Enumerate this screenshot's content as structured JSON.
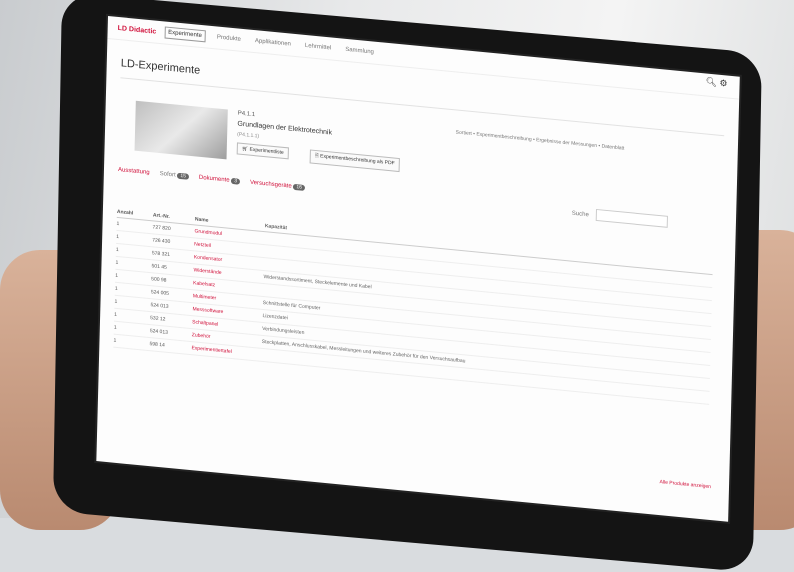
{
  "page": {
    "title": "LD-Experimente",
    "brand": "LD Didactic",
    "nav_tabs": [
      "Experimente",
      "Produkte",
      "Applikationen",
      "Lehrmittel",
      "Sammlung"
    ],
    "search_icon": "search-icon",
    "settings_icon": "gear-icon"
  },
  "product": {
    "number": "P4.1.1",
    "name": "Grundlagen der Elektrotechnik",
    "variant": "(P4.1.1.1)",
    "cart_label": "Experimentliste",
    "pdf_label": "Experimentbeschreibung als PDF",
    "info": "Sortiert • Experimentbeschreibung • Ergebnisse der Messungen • Datenblatt"
  },
  "tabs": {
    "items": [
      {
        "label": "Ausstattung",
        "active": true
      },
      {
        "label": "Sofort",
        "badge": "15",
        "active": false
      },
      {
        "label": "Dokumente",
        "badge": "3",
        "active": true
      },
      {
        "label": "Versuchsgeräte",
        "badge": "16",
        "active": true
      }
    ],
    "filter_label": "Suche"
  },
  "table": {
    "headers": [
      "Anzahl",
      "Art.-Nr.",
      "Name",
      "Kapazität"
    ],
    "rows": [
      {
        "qty": "1",
        "art": "727 820",
        "name": "Grundmodul",
        "desc": ""
      },
      {
        "qty": "1",
        "art": "726 430",
        "name": "Netzteil",
        "desc": ""
      },
      {
        "qty": "1",
        "art": "578 321",
        "name": "Kondensator",
        "desc": ""
      },
      {
        "qty": "1",
        "art": "501 45",
        "name": "Widerstände",
        "desc": "Widerstandssortiment, Steckelemente und Kabel"
      },
      {
        "qty": "1",
        "art": "500 98",
        "name": "Kabelsatz",
        "desc": ""
      },
      {
        "qty": "1",
        "art": "524 005",
        "name": "Multimeter",
        "desc": "Schnittstelle für Computer"
      },
      {
        "qty": "1",
        "art": "524 013",
        "name": "Messsoftware",
        "desc": "Lizenzdatei"
      },
      {
        "qty": "1",
        "art": "532 12",
        "name": "Schaltpanel",
        "desc": "Verbindungsleisten"
      },
      {
        "qty": "1",
        "art": "524 013",
        "name": "Zubehör",
        "desc": "Steckplatten, Anschlusskabel, Messleitungen und weiteres Zubehör für den Versuchsaufbau"
      },
      {
        "qty": "1",
        "art": "598 14",
        "name": "Experimentiertafel",
        "desc": ""
      }
    ],
    "footer_link": "Alle Produkte anzeigen"
  }
}
